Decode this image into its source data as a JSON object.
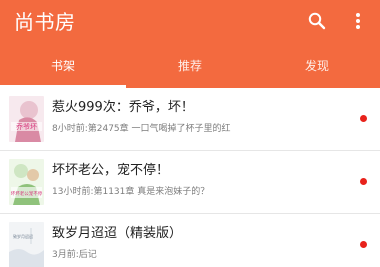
{
  "app": {
    "title": "尚书房",
    "accent_color": "#f36a3f"
  },
  "toolbar": {
    "search_icon": "search-icon",
    "more_icon": "more-vert-icon"
  },
  "tabs": [
    {
      "label": "书架",
      "selected": true
    },
    {
      "label": "推荐",
      "selected": false
    },
    {
      "label": "发现",
      "selected": false
    }
  ],
  "books": [
    {
      "title": "惹火999次：乔爷，坏！",
      "meta": "8小时前:第2475章 一口气喝掉了杯子里的红",
      "cover_text": "乔爷坏",
      "has_update": true
    },
    {
      "title": "坏坏老公，宠不停！",
      "meta": "13小时前:第1131章 真是来泡妹子的？",
      "cover_text": "坏坏老公宠不停",
      "has_update": true
    },
    {
      "title": "致岁月迢迢（精装版）",
      "meta": "3月前:后记",
      "cover_text": "致岁月迢迢",
      "has_update": true
    }
  ]
}
